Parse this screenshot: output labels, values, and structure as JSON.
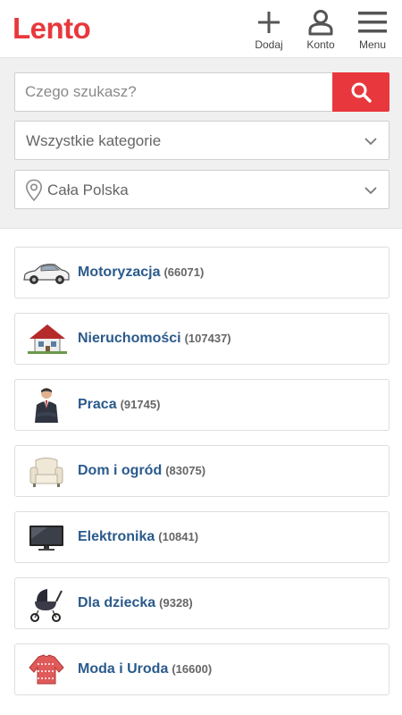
{
  "header": {
    "logo": "Lento",
    "nav": [
      {
        "label": "Dodaj",
        "icon": "plus-icon"
      },
      {
        "label": "Konto",
        "icon": "user-icon"
      },
      {
        "label": "Menu",
        "icon": "hamburger-icon"
      }
    ]
  },
  "search": {
    "placeholder": "Czego szukasz?",
    "button_icon": "search-icon",
    "category_select": "Wszystkie kategorie",
    "location_select": "Cała Polska"
  },
  "categories": [
    {
      "name": "Motoryzacja",
      "count": "(66071)",
      "icon": "car-icon"
    },
    {
      "name": "Nieruchomości",
      "count": "(107437)",
      "icon": "house-icon"
    },
    {
      "name": "Praca",
      "count": "(91745)",
      "icon": "businessman-icon"
    },
    {
      "name": "Dom i ogród",
      "count": "(83075)",
      "icon": "armchair-icon"
    },
    {
      "name": "Elektronika",
      "count": "(10841)",
      "icon": "tv-icon"
    },
    {
      "name": "Dla dziecka",
      "count": "(9328)",
      "icon": "stroller-icon"
    },
    {
      "name": "Moda i Uroda",
      "count": "(16600)",
      "icon": "sweater-icon"
    }
  ],
  "colors": {
    "brand_red": "#e8383d",
    "category_blue": "#2a5a8c"
  }
}
